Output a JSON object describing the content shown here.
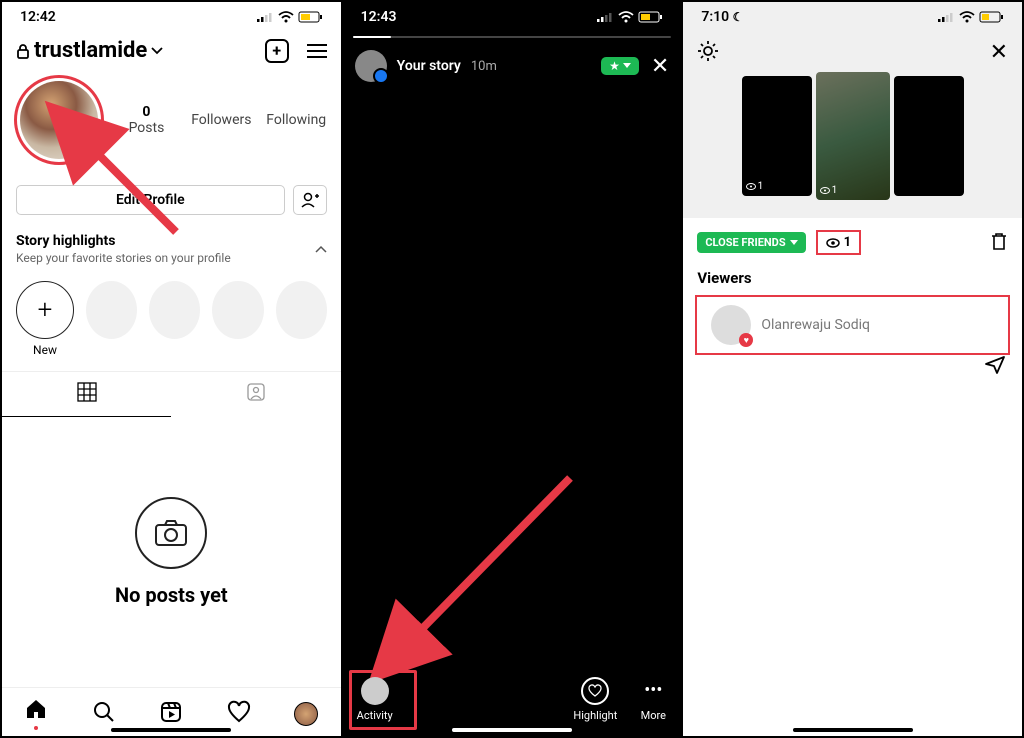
{
  "phone1": {
    "status": {
      "time": "12:42"
    },
    "nav": {
      "username": "trustlamide"
    },
    "stats": {
      "posts_n": "0",
      "posts_l": "Posts",
      "followers_l": "Followers",
      "following_l": "Following"
    },
    "edit": {
      "label": "Edit Profile"
    },
    "highlights": {
      "title": "Story highlights",
      "sub": "Keep your favorite stories on your profile",
      "new_label": "New"
    },
    "empty": {
      "text": "No posts yet"
    }
  },
  "phone2": {
    "status": {
      "time": "12:43"
    },
    "story": {
      "title": "Your story",
      "time": "10m"
    },
    "foot": {
      "activity": "Activity",
      "highlight": "Highlight",
      "more": "More"
    }
  },
  "phone3": {
    "status": {
      "time": "7:10"
    },
    "thumbs": {
      "count": "1"
    },
    "cf": "CLOSE FRIENDS",
    "views": "1",
    "viewers_label": "Viewers",
    "viewer": {
      "name": "Olanrewaju Sodiq"
    }
  }
}
